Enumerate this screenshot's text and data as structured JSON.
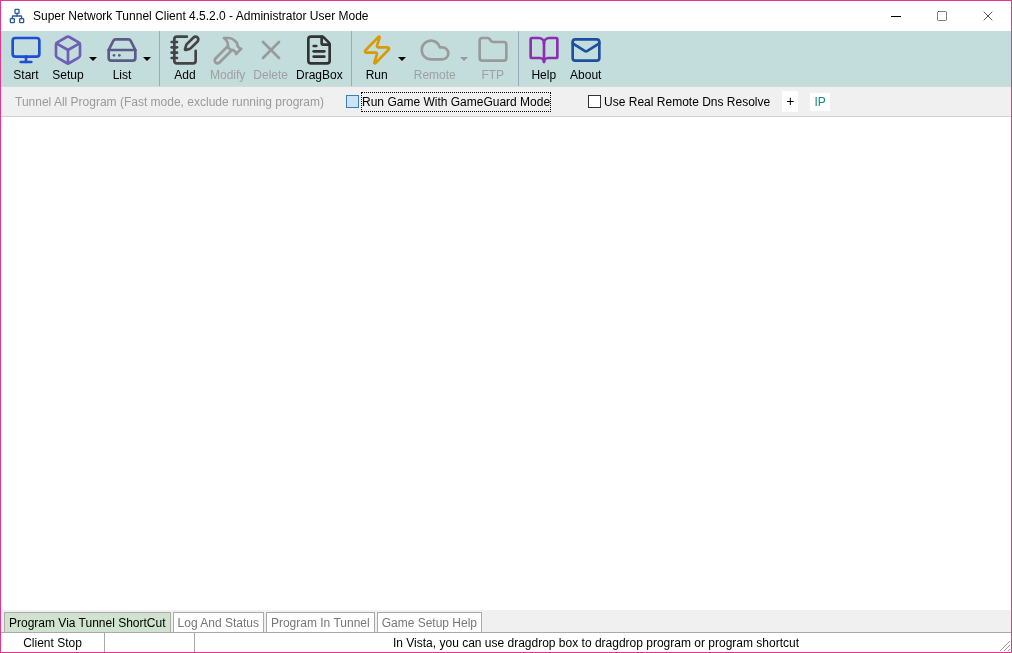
{
  "window": {
    "title": "Super Network Tunnel Client 4.5.2.0 - Administrator User Mode"
  },
  "toolbar": {
    "groups": [
      {
        "buttons": [
          {
            "label": "Start",
            "disabled": false,
            "dropdown": false
          },
          {
            "label": "Setup",
            "disabled": false,
            "dropdown": true
          },
          {
            "label": "List",
            "disabled": false,
            "dropdown": true
          }
        ]
      },
      {
        "buttons": [
          {
            "label": "Add",
            "disabled": false,
            "dropdown": false
          },
          {
            "label": "Modify",
            "disabled": true,
            "dropdown": false
          },
          {
            "label": "Delete",
            "disabled": true,
            "dropdown": false
          },
          {
            "label": "DragBox",
            "disabled": false,
            "dropdown": false
          }
        ]
      },
      {
        "buttons": [
          {
            "label": "Run",
            "disabled": false,
            "dropdown": true
          },
          {
            "label": "Remote",
            "disabled": true,
            "dropdown": true
          },
          {
            "label": "FTP",
            "disabled": true,
            "dropdown": false
          }
        ]
      },
      {
        "buttons": [
          {
            "label": "Help",
            "disabled": false,
            "dropdown": false
          },
          {
            "label": "About",
            "disabled": false,
            "dropdown": false
          }
        ]
      }
    ]
  },
  "options": {
    "tunnel_all": {
      "label": "Tunnel All Program (Fast mode, exclude running program)",
      "disabled": true
    },
    "checkboxes": [
      {
        "label": "Run Game With GameGuard Mode",
        "checked": false,
        "focused": true
      },
      {
        "label": "Use Real Remote Dns Resolve",
        "checked": false,
        "focused": false
      }
    ],
    "buttons": [
      "+",
      "IP"
    ]
  },
  "tabs": [
    {
      "label": "Program Via Tunnel ShortCut",
      "selected": true
    },
    {
      "label": "Log And Status",
      "selected": false
    },
    {
      "label": "Program In Tunnel",
      "selected": false
    },
    {
      "label": "Game Setup Help",
      "selected": false
    }
  ],
  "status_bar": {
    "state": "Client Stop",
    "message": "In Vista, you can use dragdrop box to dragdrop program or program shortcut"
  }
}
